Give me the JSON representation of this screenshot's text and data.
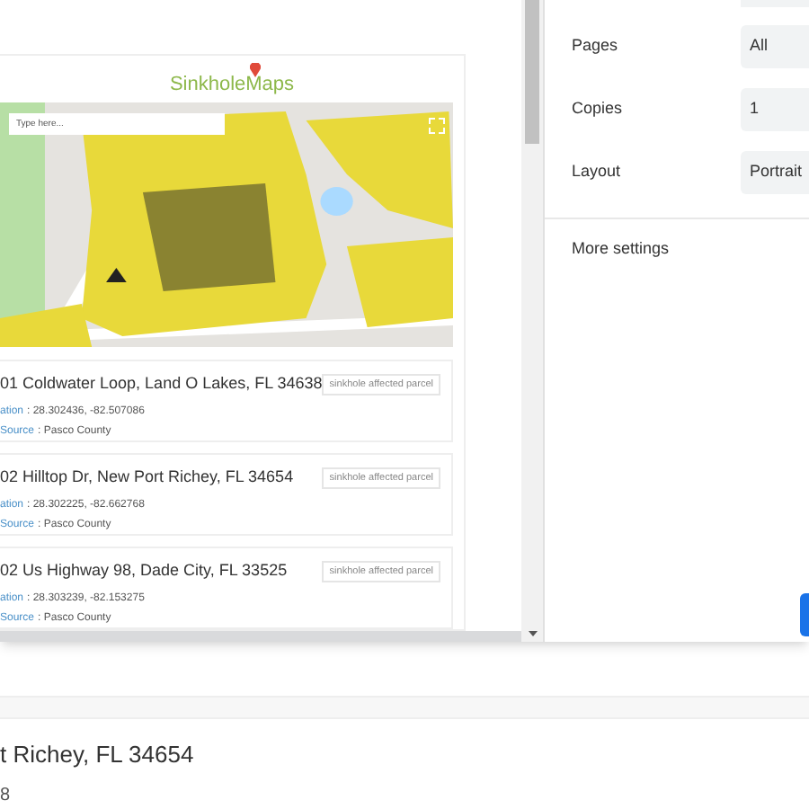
{
  "preview": {
    "logo": "SinkholeMaps",
    "map": {
      "kind": "picture",
      "search": {
        "placeholder": "Type here..."
      }
    },
    "results": [
      {
        "address": "01 Coldwater Loop, Land O Lakes, FL 34638",
        "tag": "sinkhole affected parcel",
        "location_label": "ation",
        "location": ": 28.302436, -82.507086",
        "source_label": "Source",
        "source": ": Pasco County"
      },
      {
        "address": "02 Hilltop Dr, New Port Richey, FL 34654",
        "tag": "sinkhole affected parcel",
        "location_label": "ation",
        "location": ": 28.302225, -82.662768",
        "source_label": "Source",
        "source": ": Pasco County"
      },
      {
        "address": "02 Us Highway 98, Dade City, FL 33525",
        "tag": "sinkhole affected parcel",
        "location_label": "ation",
        "location": ": 28.303239, -82.153275",
        "source_label": "Source",
        "source": ": Pasco County"
      }
    ]
  },
  "settings": [
    {
      "label": "Pages",
      "value": "All"
    },
    {
      "label": "Copies",
      "value": "1"
    },
    {
      "label": "Layout",
      "value": "Portrait"
    }
  ],
  "more_settings": "More settings",
  "background_page": {
    "address": "t Richey, FL 34654",
    "detail": "8"
  }
}
